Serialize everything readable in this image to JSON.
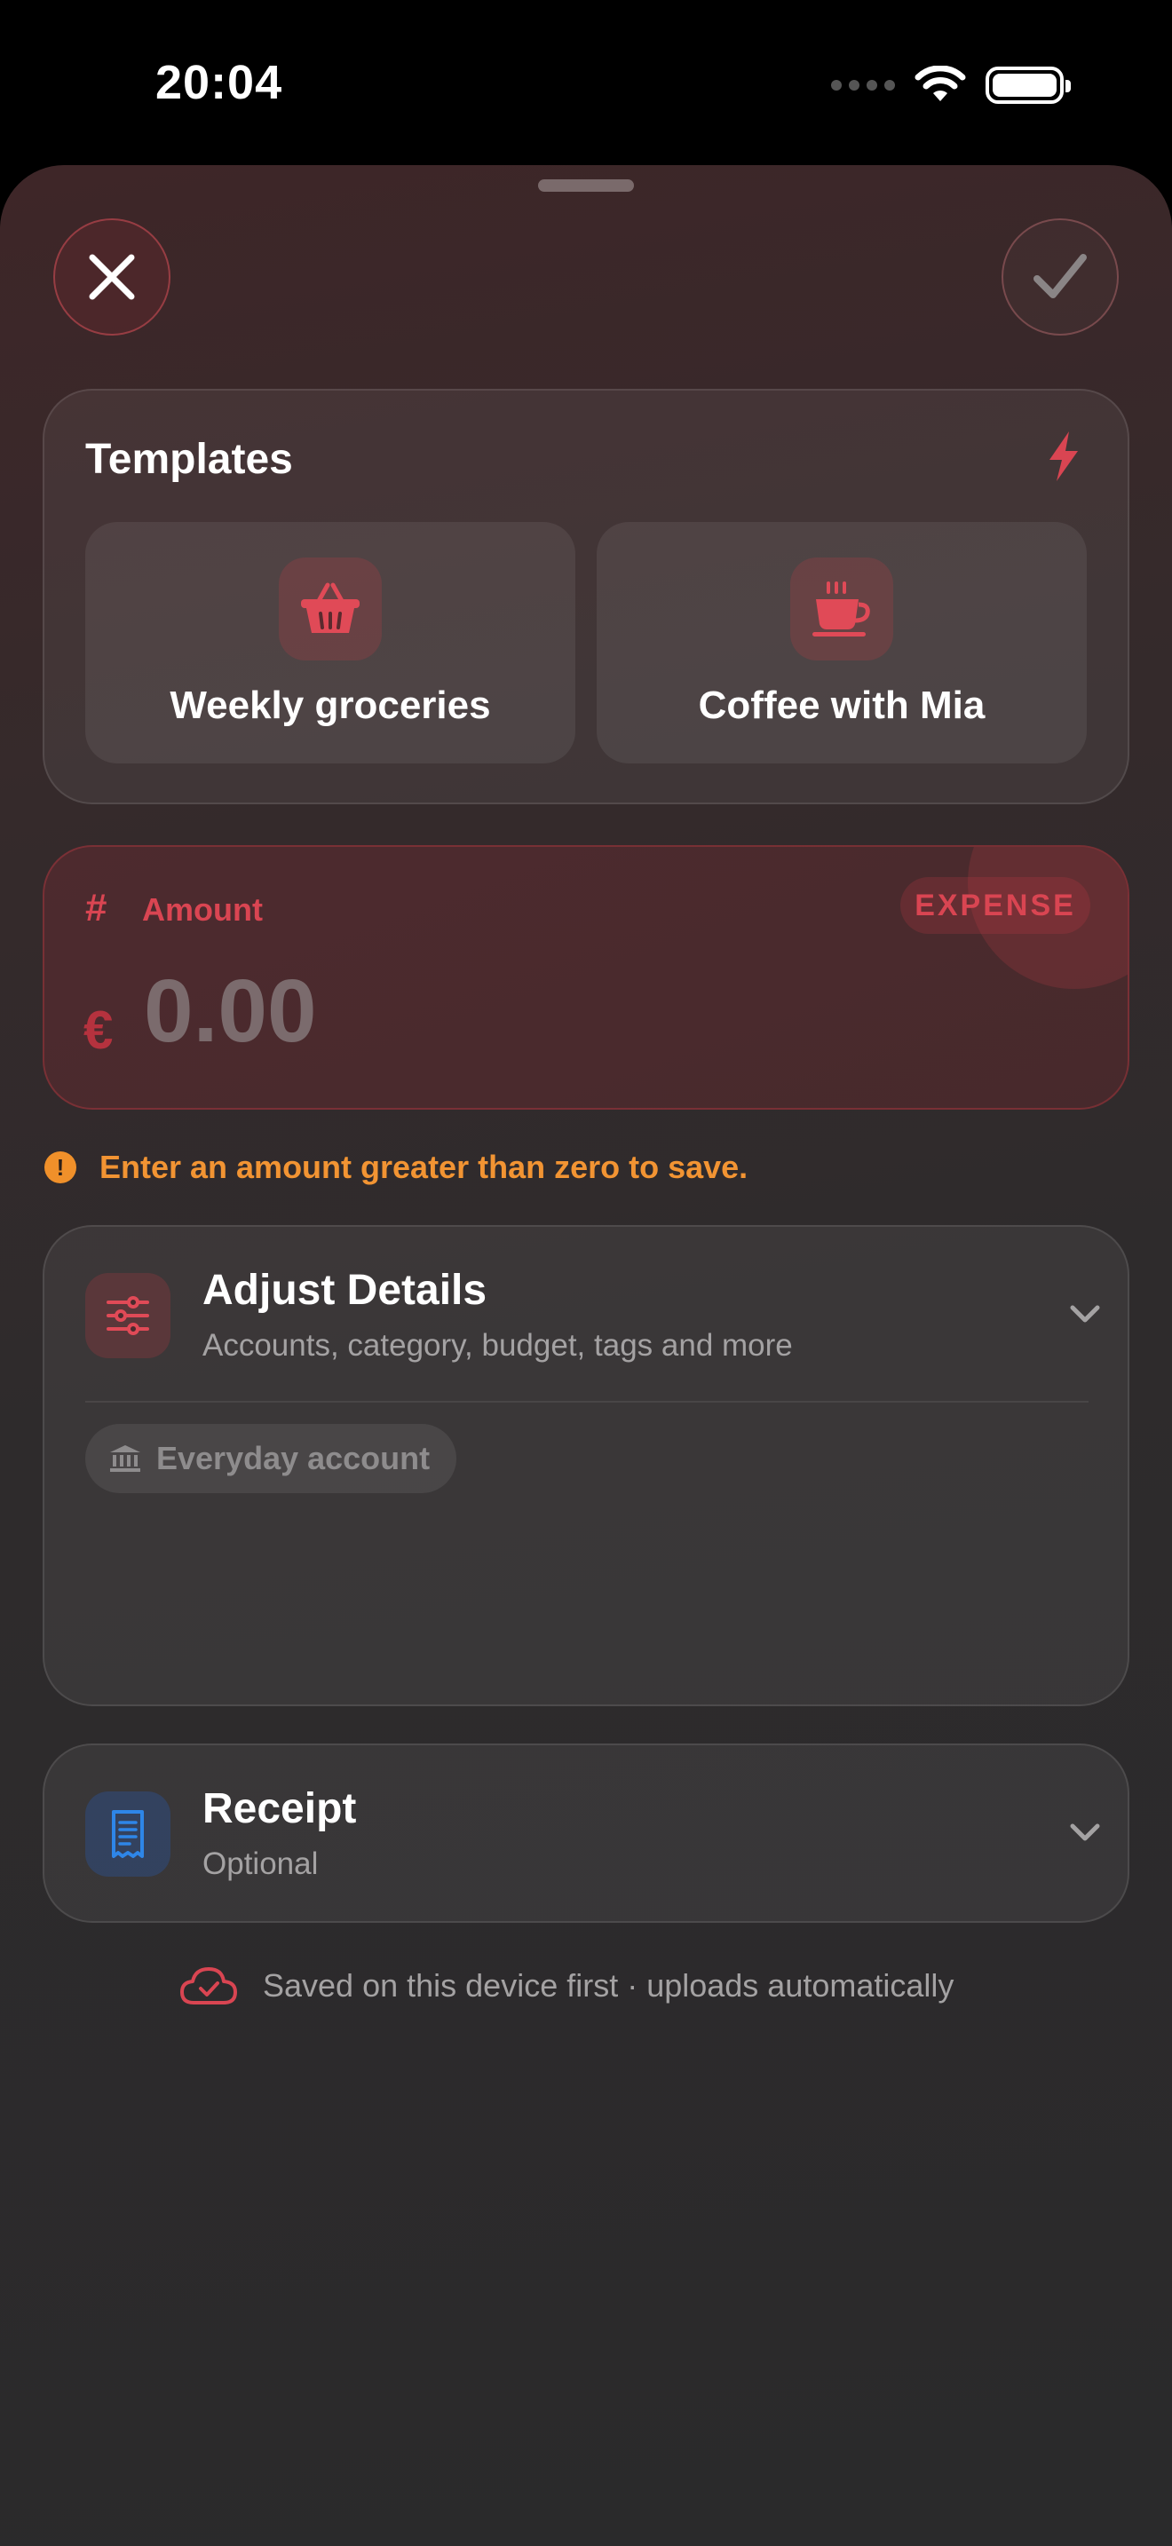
{
  "status_bar": {
    "time": "20:04"
  },
  "header": {
    "close_icon": "close-icon",
    "confirm_icon": "checkmark-icon"
  },
  "templates": {
    "title": "Templates",
    "icon": "bolt-icon",
    "items": [
      {
        "label": "Weekly groceries",
        "icon": "basket-icon"
      },
      {
        "label": "Coffee with Mia",
        "icon": "coffee-cup-icon"
      }
    ]
  },
  "amount": {
    "label": "Amount",
    "type_badge": "EXPENSE",
    "currency_symbol": "€",
    "value": "0.00"
  },
  "validation": {
    "message": "Enter an amount greater than zero to save."
  },
  "details": {
    "title": "Adjust Details",
    "subtitle": "Accounts, category, budget, tags and more",
    "account_chip": "Everyday account"
  },
  "receipt": {
    "title": "Receipt",
    "subtitle": "Optional"
  },
  "footer": {
    "sync_text": "Saved on this device first · uploads automatically"
  },
  "colors": {
    "accent": "#d94552",
    "warning": "#f29433",
    "receipt_accent": "#2e86e8"
  }
}
